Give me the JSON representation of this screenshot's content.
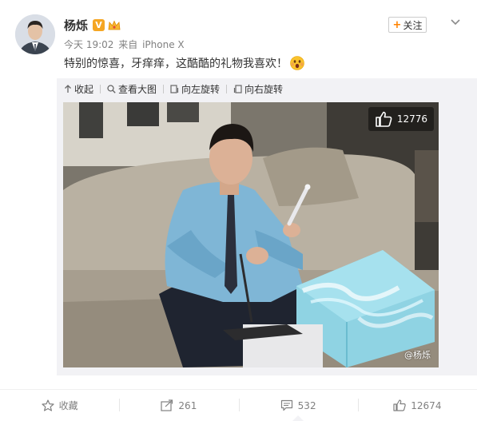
{
  "post": {
    "author": "杨烁",
    "verified_badge": "V",
    "time": "今天 19:02",
    "source_prefix": "来自",
    "source": "iPhone X",
    "follow_label": "关注",
    "text": "特别的惊喜，牙痒痒，这酷酷的礼物我喜欢！",
    "emoji": "surprised-face-icon"
  },
  "toolbar": {
    "collapse": "收起",
    "view_large": "查看大图",
    "rotate_left": "向左旋转",
    "rotate_right": "向右旋转"
  },
  "photo": {
    "like_count": "12776",
    "watermark": "@杨烁"
  },
  "actions": {
    "favorite": "收藏",
    "repost": "261",
    "comment": "532",
    "like": "12674"
  },
  "colors": {
    "accent": "#ff8200",
    "badge": "#f5a623",
    "muted": "#808080",
    "panel": "#f2f2f5"
  }
}
